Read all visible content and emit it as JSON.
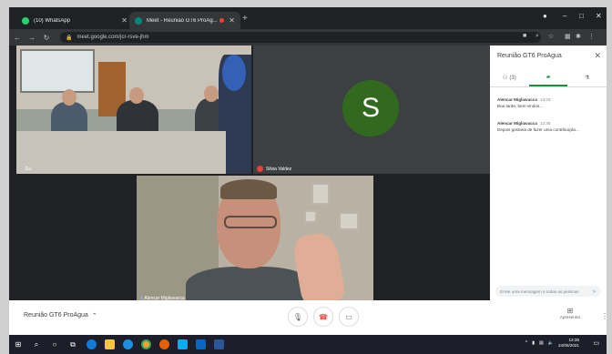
{
  "browser": {
    "tabs": [
      {
        "label": "(10) WhatsApp",
        "favicon_color": "#25d366"
      },
      {
        "label": "Meet - Reunião GT6 ProAg...",
        "favicon_color": "#00897b"
      }
    ],
    "url": "meet.google.com/jcr-rsve-jhm"
  },
  "participants": {
    "tile1_name": "Eu",
    "tile2_name": "Silvia Valdez",
    "tile2_initial": "S",
    "tile3_name": "Alencar Migliavacca"
  },
  "panel": {
    "title": "Reunião GT6 ProAgua",
    "people_count": "(3)",
    "messages": [
      {
        "sender": "Alencar Migliavacca",
        "time": "13:33",
        "text": "Boa tarde, bem-vindos..."
      },
      {
        "sender": "Alencar Migliavacca",
        "time": "13:35",
        "text": "Depois gostaria de fazer uma contribuição..."
      }
    ],
    "compose_placeholder": "Envie uma mensagem a todas as pessoas"
  },
  "controls": {
    "meeting_name": "Reunião GT6 ProAgua",
    "present_label": "Apresentar"
  },
  "taskbar": {
    "time": "13:35",
    "date": "24/05/2021"
  },
  "colors": {
    "avatar_bg": "#33691e",
    "hangup": "#ea4335",
    "active_tab_accent": "#1e8e3e"
  }
}
